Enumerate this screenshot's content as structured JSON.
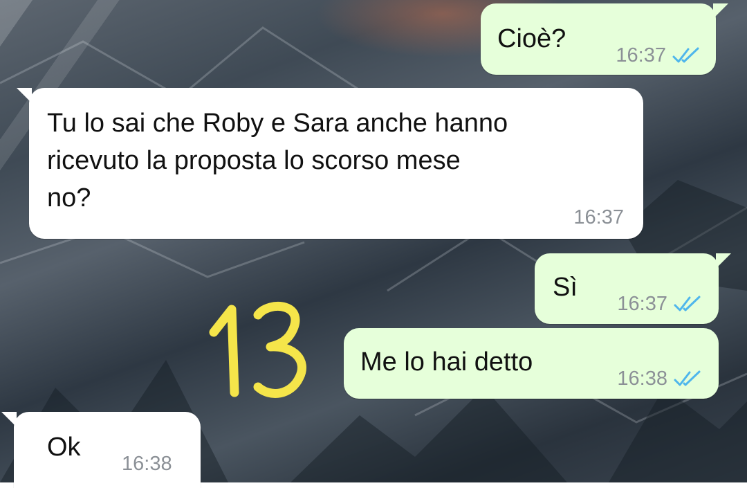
{
  "messages": [
    {
      "direction": "outgoing",
      "text": "Cioè?",
      "time": "16:37",
      "status_icon": "double-check-read-icon"
    },
    {
      "direction": "incoming",
      "text": "Tu lo sai che Roby e Sara anche hanno\nricevuto la proposta lo scorso mese\nno?",
      "time": "16:37"
    },
    {
      "direction": "outgoing",
      "text": "Sì",
      "time": "16:37",
      "status_icon": "double-check-read-icon"
    },
    {
      "direction": "outgoing",
      "text": "Me lo hai detto",
      "time": "16:38",
      "status_icon": "double-check-read-icon"
    },
    {
      "direction": "incoming",
      "text": "Ok",
      "time": "16:38"
    }
  ],
  "annotation": {
    "text": "13",
    "color": "#f5e54a"
  },
  "colors": {
    "outgoing_bubble": "#e6ffda",
    "incoming_bubble": "#ffffff",
    "read_tick": "#4fb6ec",
    "timestamp": "#8b9096"
  }
}
